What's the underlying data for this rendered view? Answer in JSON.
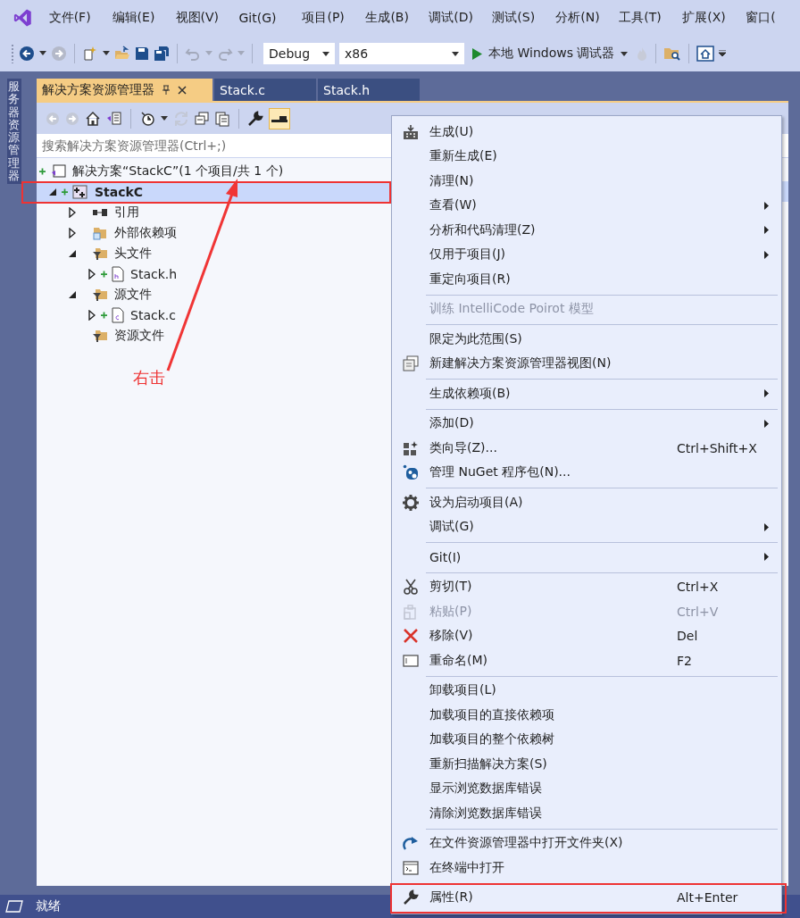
{
  "menu_bar": {
    "items": [
      "文件(F)",
      "编辑(E)",
      "视图(V)",
      "Git(G)",
      "项目(P)",
      "生成(B)",
      "调试(D)",
      "测试(S)",
      "分析(N)",
      "工具(T)",
      "扩展(X)",
      "窗口("
    ]
  },
  "toolbar": {
    "configuration": "Debug",
    "platform": "x86",
    "run_label": "本地 Windows 调试器"
  },
  "side_tab": {
    "label": "服务器资源管理器"
  },
  "doc_tabs": [
    {
      "label": "解决方案资源管理器",
      "selected": true
    },
    {
      "label": "Stack.c",
      "selected": false
    },
    {
      "label": "Stack.h",
      "selected": false
    }
  ],
  "search": {
    "placeholder": "搜索解决方案资源管理器(Ctrl+;)"
  },
  "tree": [
    {
      "label": "解决方案“StackC”(1 个项目/共 1 个)",
      "kind": "solution",
      "selected": false,
      "marked": false,
      "children": [
        {
          "label": "StackC",
          "kind": "project",
          "expanded": true,
          "selected": true,
          "marked": true,
          "children": [
            {
              "label": "引用",
              "kind": "references",
              "expanded": false,
              "selected": false,
              "marked": false
            },
            {
              "label": "外部依赖项",
              "kind": "external",
              "expanded": false,
              "selected": false,
              "marked": false
            },
            {
              "label": "头文件",
              "kind": "filter",
              "expanded": true,
              "selected": false,
              "marked": false,
              "children": [
                {
                  "label": "Stack.h",
                  "kind": "header",
                  "expanded": false,
                  "selected": false,
                  "marked": false
                }
              ]
            },
            {
              "label": "源文件",
              "kind": "filter",
              "expanded": true,
              "selected": false,
              "marked": false,
              "children": [
                {
                  "label": "Stack.c",
                  "kind": "source",
                  "expanded": false,
                  "selected": false,
                  "marked": false
                }
              ]
            },
            {
              "label": "资源文件",
              "kind": "filter",
              "selected": false,
              "marked": false
            }
          ]
        }
      ]
    }
  ],
  "callout": {
    "text": "右击"
  },
  "context_menu": {
    "sections": [
      [
        {
          "label": "生成(U)",
          "submenu": false,
          "disabled": false,
          "marked": false
        },
        {
          "label": "重新生成(E)",
          "submenu": false,
          "disabled": false,
          "marked": false
        },
        {
          "label": "清理(N)",
          "submenu": false,
          "disabled": false,
          "marked": false
        },
        {
          "label": "查看(W)",
          "submenu": true,
          "disabled": false,
          "marked": false
        },
        {
          "label": "分析和代码清理(Z)",
          "submenu": true,
          "disabled": false,
          "marked": false
        },
        {
          "label": "仅用于项目(J)",
          "submenu": true,
          "disabled": false,
          "marked": false
        },
        {
          "label": "重定向项目(R)",
          "submenu": false,
          "disabled": false,
          "marked": false
        }
      ],
      [
        {
          "label": "训练 IntelliCode Poirot 模型",
          "submenu": false,
          "disabled": true,
          "marked": false
        }
      ],
      [
        {
          "label": "限定为此范围(S)",
          "submenu": false,
          "disabled": false,
          "marked": false
        },
        {
          "label": "新建解决方案资源管理器视图(N)",
          "submenu": false,
          "disabled": false,
          "marked": false
        }
      ],
      [
        {
          "label": "生成依赖项(B)",
          "submenu": true,
          "disabled": false,
          "marked": false
        }
      ],
      [
        {
          "label": "添加(D)",
          "submenu": true,
          "disabled": false,
          "marked": false
        },
        {
          "label": "类向导(Z)...",
          "shortcut": "Ctrl+Shift+X",
          "submenu": false,
          "disabled": false,
          "marked": false
        },
        {
          "label": "管理 NuGet 程序包(N)...",
          "submenu": false,
          "disabled": false,
          "marked": false
        }
      ],
      [
        {
          "label": "设为启动项目(A)",
          "submenu": false,
          "disabled": false,
          "marked": false
        },
        {
          "label": "调试(G)",
          "submenu": true,
          "disabled": false,
          "marked": false
        }
      ],
      [
        {
          "label": "Git(I)",
          "submenu": true,
          "disabled": false,
          "marked": false
        }
      ],
      [
        {
          "label": "剪切(T)",
          "shortcut": "Ctrl+X",
          "submenu": false,
          "disabled": false,
          "marked": false
        },
        {
          "label": "粘贴(P)",
          "shortcut": "Ctrl+V",
          "submenu": false,
          "disabled": true,
          "marked": false
        },
        {
          "label": "移除(V)",
          "shortcut": "Del",
          "submenu": false,
          "disabled": false,
          "marked": false
        },
        {
          "label": "重命名(M)",
          "shortcut": "F2",
          "submenu": false,
          "disabled": false,
          "marked": false
        }
      ],
      [
        {
          "label": "卸载项目(L)",
          "submenu": false,
          "disabled": false,
          "marked": false
        },
        {
          "label": "加载项目的直接依赖项",
          "submenu": false,
          "disabled": false,
          "marked": false
        },
        {
          "label": "加载项目的整个依赖树",
          "submenu": false,
          "disabled": false,
          "marked": false
        },
        {
          "label": "重新扫描解决方案(S)",
          "submenu": false,
          "disabled": false,
          "marked": false
        },
        {
          "label": "显示浏览数据库错误",
          "submenu": false,
          "disabled": false,
          "marked": false
        },
        {
          "label": "清除浏览数据库错误",
          "submenu": false,
          "disabled": false,
          "marked": false
        }
      ],
      [
        {
          "label": "在文件资源管理器中打开文件夹(X)",
          "submenu": false,
          "disabled": false,
          "marked": false
        },
        {
          "label": "在终端中打开",
          "submenu": false,
          "disabled": false,
          "marked": false
        }
      ],
      [
        {
          "label": "属性(R)",
          "shortcut": "Alt+Enter",
          "submenu": false,
          "disabled": false,
          "marked": true
        }
      ]
    ]
  },
  "status_bar": {
    "text": "就绪"
  }
}
